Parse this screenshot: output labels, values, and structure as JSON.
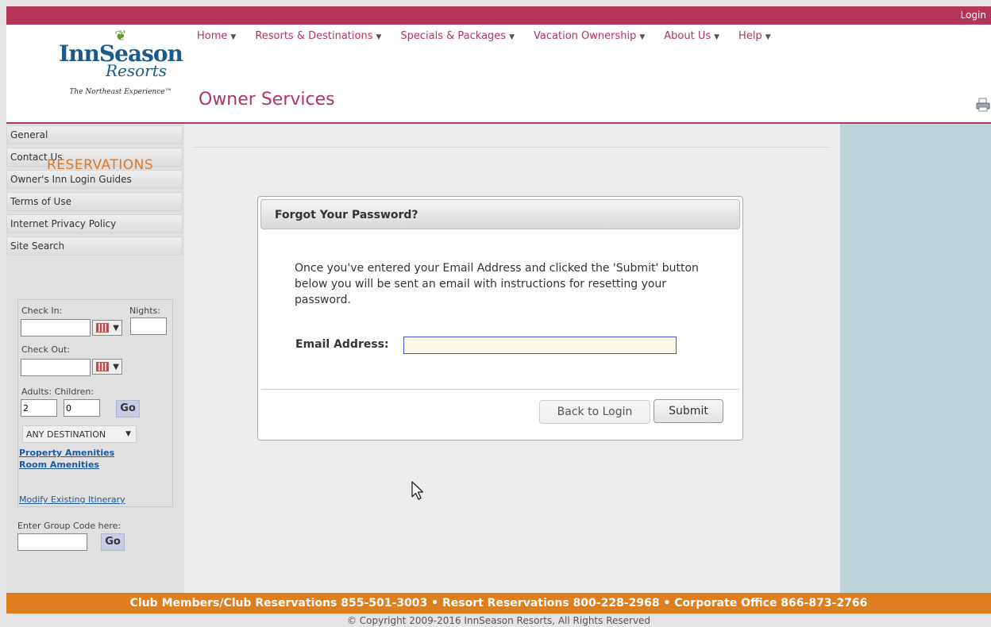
{
  "topbar": {
    "login": "Login"
  },
  "logo": {
    "line1": "InnSeason",
    "line2": "Resorts",
    "tagline": "The Northeast Experience™"
  },
  "nav": [
    {
      "label": "Home"
    },
    {
      "label": "Resorts & Destinations"
    },
    {
      "label": "Specials & Packages"
    },
    {
      "label": "Vacation Ownership"
    },
    {
      "label": "About Us"
    },
    {
      "label": "Help"
    }
  ],
  "page_title": "Owner Services",
  "sidebar": {
    "items": [
      {
        "label": "General"
      },
      {
        "label": "Contact Us"
      },
      {
        "label": "Owner's Inn Login Guides"
      },
      {
        "label": "Terms of Use"
      },
      {
        "label": "Internet Privacy Policy"
      },
      {
        "label": "Site Search"
      }
    ]
  },
  "reservations": {
    "title": "RESERVATIONS",
    "check_in_label": "Check In:",
    "nights_label": "Nights:",
    "check_out_label": "Check Out:",
    "adults_children_label": "Adults: Children:",
    "adults_value": "2",
    "children_value": "0",
    "go_label": "Go",
    "destination": "ANY DESTINATION",
    "property_amenities": "Property Amenities",
    "room_amenities": "Room Amenities",
    "modify_itinerary": "Modify Existing Itinerary",
    "group_code_label": "Enter Group Code here:",
    "group_go_label": "Go"
  },
  "dialog": {
    "title": "Forgot Your Password?",
    "message": "Once you've entered your Email Address and clicked the 'Submit' button below you will be sent an email with instructions for resetting your password.",
    "email_label": "Email Address:",
    "email_value": "",
    "back_label": "Back to Login",
    "submit_label": "Submit"
  },
  "footer": {
    "contacts": "Club Members/Club Reservations 855-501-3003  •  Resort Reservations 800-228-2968  •  Corporate Office 866-873-2766",
    "copyright": "© Copyright 2009-2016 InnSeason Resorts, All Rights Reserved"
  },
  "colors": {
    "brand": "#b5345a",
    "accent_orange": "#de7e1e",
    "right_panel": "#bfd4d8"
  },
  "icons": [
    "printer-icon",
    "calendar-icon",
    "cursor-icon"
  ]
}
